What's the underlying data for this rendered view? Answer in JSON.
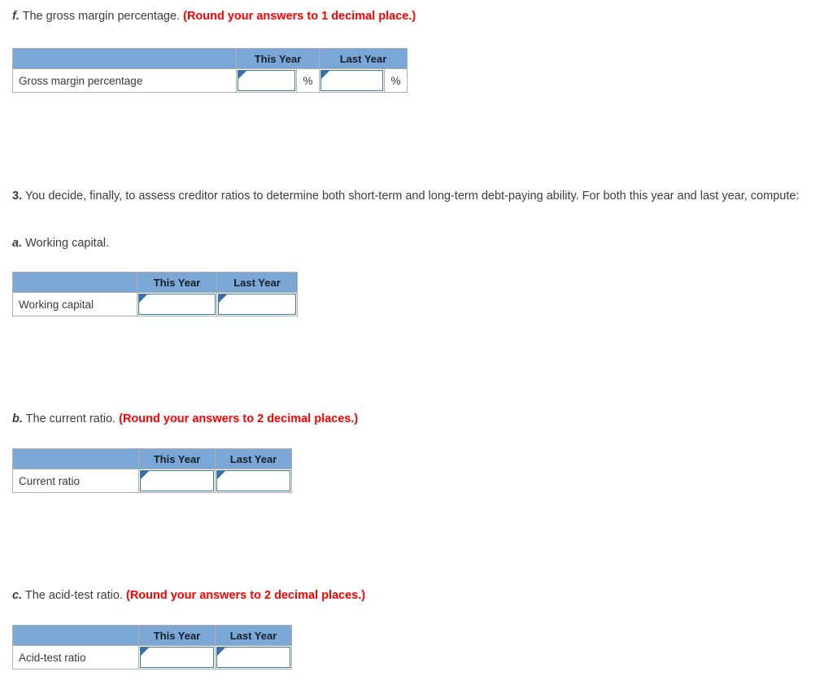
{
  "page": {
    "background": "#ffffff",
    "accent_header": "#7ba7d7",
    "input_border": "#3c78b4",
    "note_color": "#ff0000",
    "grid_border": "#b0b0b0"
  },
  "sections": [
    {
      "id": "f",
      "prefix": "f.",
      "prompt": "The gross margin percentage.",
      "note": "(Round your answers to 1 decimal place.)",
      "table": {
        "headers": [
          "",
          "This Year",
          "Last Year"
        ],
        "rows": [
          {
            "label": "Gross margin percentage",
            "this_year_value": "",
            "last_year_value": "",
            "suffix": "%"
          }
        ]
      }
    },
    {
      "id": "q3",
      "prefix": "3.",
      "paragraph": "You decide, finally, to assess creditor ratios to determine both short-term and long-term debt-paying ability. For both this year and last year, compute:"
    },
    {
      "id": "a",
      "prefix": "a.",
      "prompt": "Working capital.",
      "note": "",
      "table": {
        "headers": [
          "",
          "This Year",
          "Last Year"
        ],
        "rows": [
          {
            "label": "Working capital",
            "this_year_value": "",
            "last_year_value": "",
            "suffix": ""
          }
        ]
      }
    },
    {
      "id": "b",
      "prefix": "b.",
      "prompt": "The current ratio.",
      "note": "(Round your answers to 2 decimal places.)",
      "table": {
        "headers": [
          "",
          "This Year",
          "Last Year"
        ],
        "rows": [
          {
            "label": "Current ratio",
            "this_year_value": "",
            "last_year_value": "",
            "suffix": ""
          }
        ]
      }
    },
    {
      "id": "c",
      "prefix": "c.",
      "prompt": "The acid-test ratio.",
      "note": "(Round your answers to 2 decimal places.)",
      "table": {
        "headers": [
          "",
          "This Year",
          "Last Year"
        ],
        "rows": [
          {
            "label": "Acid-test ratio",
            "this_year_value": "",
            "last_year_value": "",
            "suffix": ""
          }
        ]
      }
    }
  ]
}
